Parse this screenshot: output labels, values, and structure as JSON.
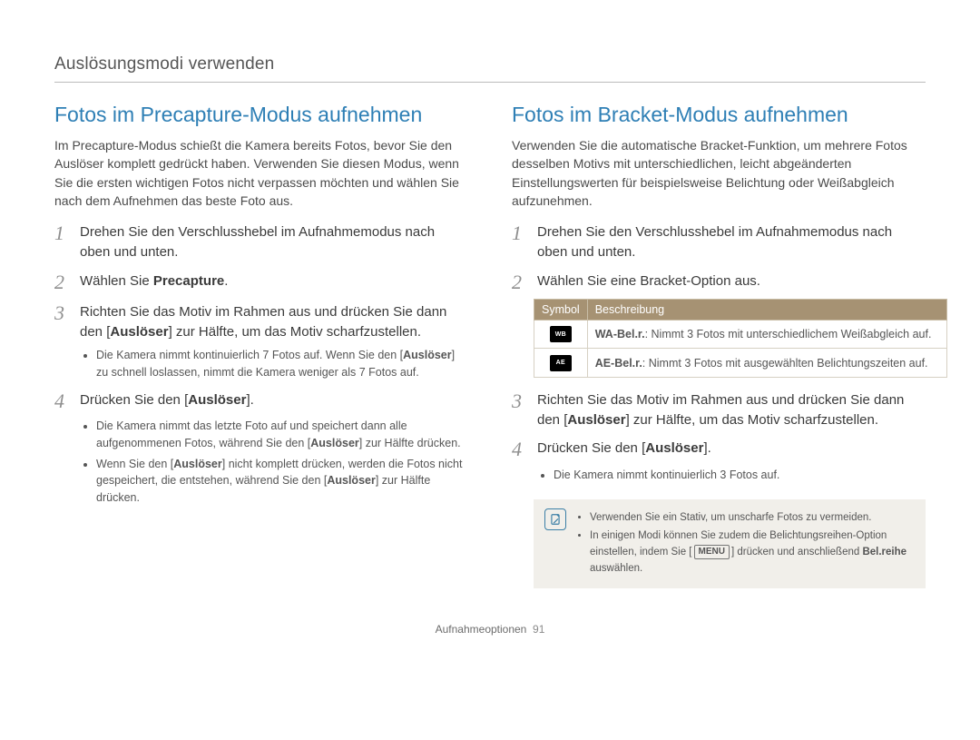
{
  "section_title": "Auslösungsmodi verwenden",
  "left": {
    "heading": "Fotos im Precapture-Modus aufnehmen",
    "intro": "Im Precapture-Modus schießt die Kamera bereits Fotos, bevor Sie den Auslöser komplett gedrückt haben. Verwenden Sie diesen Modus, wenn Sie die ersten wichtigen Fotos nicht verpassen möchten und wählen Sie nach dem Aufnehmen das beste Foto aus.",
    "steps": [
      {
        "n": "1",
        "text": "Drehen Sie den Verschlusshebel im Aufnahmemodus nach oben und unten."
      },
      {
        "n": "2",
        "pre": "Wählen Sie ",
        "bold": "Precapture",
        "post": "."
      },
      {
        "n": "3",
        "pre": "Richten Sie das Motiv im Rahmen aus und drücken Sie dann den [",
        "bold": "Auslöser",
        "post": "] zur Hälfte, um das Motiv scharfzustellen."
      },
      {
        "n": "4",
        "pre": "Drücken Sie den [",
        "bold": "Auslöser",
        "post": "]."
      }
    ],
    "sub3": [
      {
        "pre": "Die Kamera nimmt kontinuierlich 7 Fotos auf. Wenn Sie den [",
        "bold": "Auslöser",
        "post": "] zu schnell loslassen, nimmt die Kamera weniger als 7 Fotos auf."
      }
    ],
    "sub4": [
      {
        "pre": "Die Kamera nimmt das letzte Foto auf und speichert dann alle aufgenommenen Fotos, während Sie den [",
        "bold": "Auslöser",
        "post": "] zur Hälfte drücken."
      },
      {
        "pre": "Wenn Sie den [",
        "bold": "Auslöser",
        "post1": "] nicht komplett drücken, werden die Fotos nicht gespeichert, die entstehen, während Sie den [",
        "bold2": "Auslöser",
        "post2": "] zur Hälfte drücken."
      }
    ]
  },
  "right": {
    "heading": "Fotos im Bracket-Modus aufnehmen",
    "intro": "Verwenden Sie die automatische Bracket-Funktion, um mehrere Fotos desselben Motivs mit unterschiedlichen, leicht abgeänderten Einstellungswerten für beispielsweise Belichtung oder Weißabgleich aufzunehmen.",
    "steps": [
      {
        "n": "1",
        "text": "Drehen Sie den Verschlusshebel im Aufnahmemodus nach oben und unten."
      },
      {
        "n": "2",
        "text": "Wählen Sie eine Bracket-Option aus."
      },
      {
        "n": "3",
        "pre": "Richten Sie das Motiv im Rahmen aus und drücken Sie dann den [",
        "bold": "Auslöser",
        "post": "] zur Hälfte, um das Motiv scharfzustellen."
      },
      {
        "n": "4",
        "pre": "Drücken Sie den [",
        "bold": "Auslöser",
        "post": "]."
      }
    ],
    "table": {
      "headers": {
        "sym": "Symbol",
        "desc": "Beschreibung"
      },
      "rows": [
        {
          "sym": "WB",
          "bold": "WA-Bel.r.",
          "desc": ": Nimmt 3 Fotos mit unterschiedlichem Weißabgleich auf."
        },
        {
          "sym": "AE",
          "bold": "AE-Bel.r.",
          "desc": ": Nimmt 3 Fotos mit ausgewählten Belichtungszeiten auf."
        }
      ]
    },
    "sub4": [
      {
        "text": "Die Kamera nimmt kontinuierlich 3 Fotos auf."
      }
    ],
    "tips": {
      "items": [
        {
          "text": "Verwenden Sie ein Stativ, um unscharfe Fotos zu vermeiden."
        },
        {
          "pre": "In einigen Modi können Sie zudem die Belichtungsreihen-Option einstellen, indem Sie [",
          "menu": "MENU",
          "mid": "] drücken und anschließend ",
          "bold": "Bel.reihe",
          "post": " auswählen."
        }
      ]
    }
  },
  "footer": {
    "label": "Aufnahmeoptionen",
    "page": "91"
  }
}
